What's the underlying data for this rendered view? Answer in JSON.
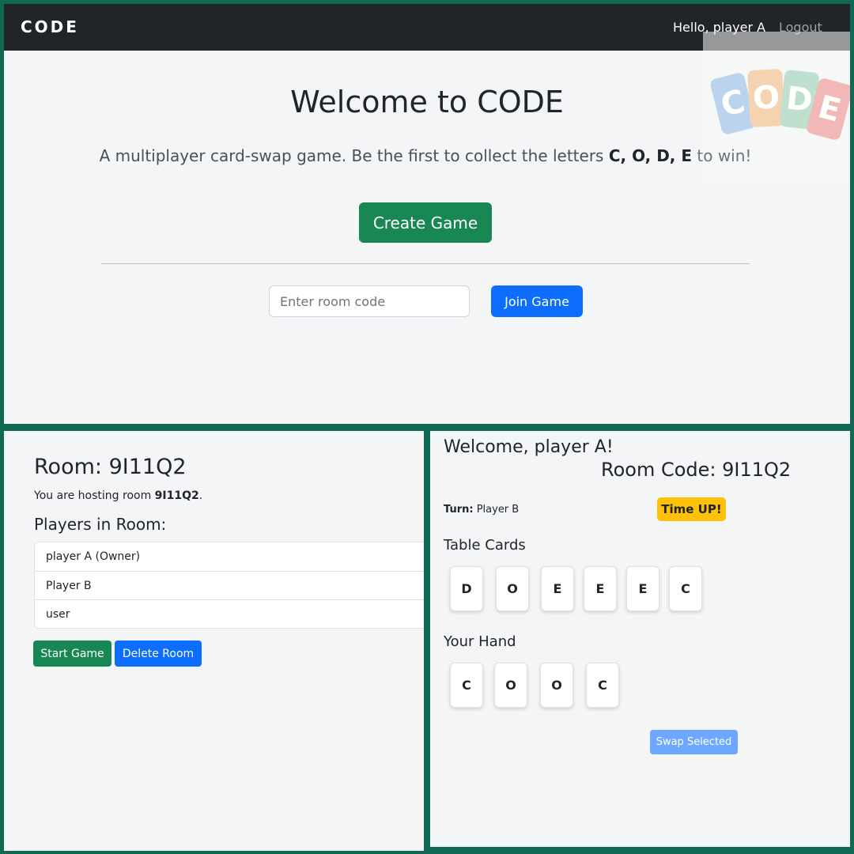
{
  "home": {
    "brand": "CODE",
    "greeting": "Hello, player A",
    "logout_label": "Logout",
    "logo_letters": [
      "C",
      "O",
      "D",
      "E"
    ],
    "logo_colors": [
      "#b9d4ec",
      "#f6d3b0",
      "#bfe0cf",
      "#f2b8b8"
    ],
    "title": "Welcome to CODE",
    "tagline_before": "A multiplayer card-swap game. Be the first to collect the letters ",
    "tagline_letters": "C, O, D, E",
    "tagline_after": " to win!",
    "create_label": "Create Game",
    "room_code_placeholder": "Enter room code",
    "join_label": "Join Game"
  },
  "room": {
    "title": "Room: 9I11Q2",
    "hosting_prefix": "You are hosting room ",
    "hosting_code": "9I11Q2",
    "hosting_suffix": ".",
    "players_heading": "Players in Room:",
    "players": [
      "player A (Owner)",
      "Player B",
      "user"
    ],
    "start_label": "Start Game",
    "delete_label": "Delete Room"
  },
  "game": {
    "welcome": "Welcome, player A!",
    "room_code": "Room Code: 9I11Q2",
    "turn_label": "Turn:",
    "turn_player": "Player B",
    "timer_label": "Time UP!",
    "table_heading": "Table Cards",
    "table_cards": [
      "D",
      "O",
      "E",
      "E",
      "E",
      "C"
    ],
    "hand_heading": "Your Hand",
    "hand_cards": [
      "C",
      "O",
      "O",
      "C"
    ],
    "swap_label": "Swap Selected"
  },
  "colors": {
    "frame": "#106a53",
    "success": "#198754",
    "primary": "#0d6efd",
    "primary_disabled": "#6ea8fe",
    "warning": "#ffc107",
    "navbar": "#212529"
  }
}
